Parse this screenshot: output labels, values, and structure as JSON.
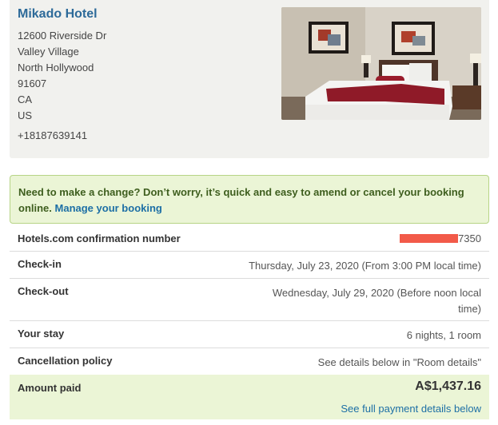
{
  "hotel": {
    "name": "Mikado Hotel",
    "address_lines": [
      "12600 Riverside Dr",
      "Valley Village",
      "North Hollywood",
      "91607",
      "CA",
      "US"
    ],
    "phone": "+18187639141"
  },
  "notice": {
    "text": "Need to make a change? Don’t worry, it’s quick and easy to amend or cancel your booking online.",
    "link": "Manage your booking"
  },
  "details": {
    "confirmation": {
      "label": "Hotels.com confirmation number",
      "value_suffix": "7350"
    },
    "checkin": {
      "label": "Check-in",
      "value": "Thursday, July 23, 2020 (From 3:00 PM local time)"
    },
    "checkout": {
      "label": "Check-out",
      "value_line1": "Wednesday, July 29, 2020 (Before noon local",
      "value_line2": "time)"
    },
    "stay": {
      "label": "Your stay",
      "value": "6 nights, 1 room"
    },
    "cancellation": {
      "label": "Cancellation policy",
      "value": "See details below in \"Room details\""
    }
  },
  "payment": {
    "label": "Amount paid",
    "amount": "A$1,437.16",
    "link": "See full payment details below"
  },
  "colors": {
    "hotel_name": "#2d6a99",
    "link": "#1d6fa5",
    "notice_bg": "#ebf5d6",
    "notice_border": "#b7d486",
    "redaction": "#f25a49"
  }
}
